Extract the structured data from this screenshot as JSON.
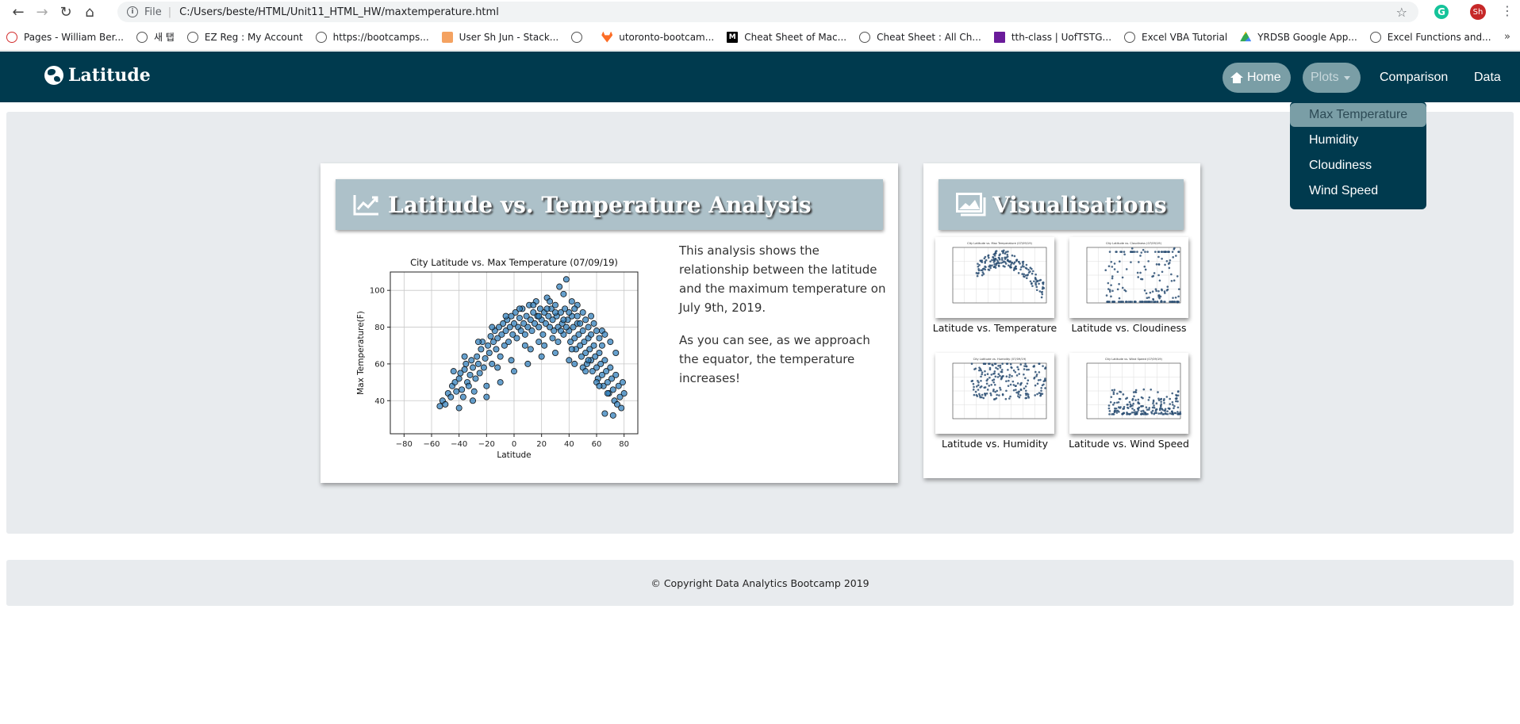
{
  "browser": {
    "address_prefix": "File",
    "url": "C:/Users/beste/HTML/Unit11_HTML_HW/maxtemperature.html",
    "grammarly_letter": "G",
    "avatar_initials": "Sh",
    "bookmarks": [
      {
        "label": "Pages - William Ber...",
        "icon": "red-swoosh-icon"
      },
      {
        "label": "새 탭",
        "icon": "globe-icon"
      },
      {
        "label": "EZ Reg : My Account",
        "icon": "globe-icon"
      },
      {
        "label": "https://bootcamps...",
        "icon": "globe-icon"
      },
      {
        "label": "User Sh Jun - Stack...",
        "icon": "stackoverflow-icon"
      },
      {
        "label": "",
        "icon": "globe-icon"
      },
      {
        "label": "utoronto-bootcam...",
        "icon": "gitlab-icon"
      },
      {
        "label": "Cheat Sheet of Mac...",
        "icon": "medium-icon"
      },
      {
        "label": "Cheat Sheet : All Ch...",
        "icon": "globe-icon"
      },
      {
        "label": "tth-class | UofTSTG...",
        "icon": "purple-square-icon"
      },
      {
        "label": "Excel VBA Tutorial",
        "icon": "globe-icon"
      },
      {
        "label": "YRDSB Google App...",
        "icon": "drive-icon"
      },
      {
        "label": "Excel Functions and...",
        "icon": "globe-icon"
      }
    ],
    "more": "»"
  },
  "nav": {
    "brand": "Latitude",
    "home": "Home",
    "plots": "Plots",
    "comparison": "Comparison",
    "data": "Data",
    "dropdown": [
      "Max Temperature",
      "Humidity",
      "Cloudiness",
      "Wind Speed"
    ]
  },
  "main": {
    "title": "Latitude vs. Temperature Analysis",
    "para1": "This analysis shows the relationship between the latitude and the maximum temperature on July 9th, 2019.",
    "para2": "As you can see, as we approach the equator, the temperature increases!"
  },
  "visualisations": {
    "title": "Visualisations",
    "thumbs": [
      {
        "label": "Latitude vs. Temperature",
        "caption": "City Latitude vs. Max Temperature (07/09/19)"
      },
      {
        "label": "Latitude vs. Cloudiness",
        "caption": "City Latitude vs. Cloudiness (07/09/19)"
      },
      {
        "label": "Latitude vs. Humidity",
        "caption": "City Latitude vs. Humidity (07/09/19)"
      },
      {
        "label": "Latitude vs. Wind Speed",
        "caption": "City Latitude vs. Wind Speed (07/09/19)"
      }
    ]
  },
  "footer": {
    "text": "© Copyright Data Analytics Bootcamp 2019"
  },
  "chart_data": {
    "type": "scatter",
    "title": "City Latitude vs. Max Temperature (07/09/19)",
    "xlabel": "Latitude",
    "ylabel": "Max Temperature(F)",
    "xlim": [
      -90,
      90
    ],
    "ylim": [
      22,
      110
    ],
    "xticks": [
      -80,
      -60,
      -40,
      -20,
      0,
      20,
      40,
      60,
      80
    ],
    "yticks": [
      40,
      60,
      80,
      100
    ],
    "grid": true,
    "marker_color": "#2b7bba",
    "points": [
      [
        -54,
        37
      ],
      [
        -52,
        40
      ],
      [
        -48,
        44
      ],
      [
        -46,
        42
      ],
      [
        -45,
        48
      ],
      [
        -43,
        50
      ],
      [
        -42,
        45
      ],
      [
        -40,
        52
      ],
      [
        -39,
        55
      ],
      [
        -38,
        46
      ],
      [
        -37,
        42
      ],
      [
        -36,
        57
      ],
      [
        -35,
        60
      ],
      [
        -34,
        50
      ],
      [
        -33,
        48
      ],
      [
        -32,
        54
      ],
      [
        -31,
        62
      ],
      [
        -30,
        58
      ],
      [
        -29,
        45
      ],
      [
        -28,
        52
      ],
      [
        -27,
        64
      ],
      [
        -26,
        60
      ],
      [
        -25,
        55
      ],
      [
        -24,
        68
      ],
      [
        -23,
        72
      ],
      [
        -22,
        58
      ],
      [
        -21,
        63
      ],
      [
        -20,
        48
      ],
      [
        -19,
        70
      ],
      [
        -18,
        66
      ],
      [
        -17,
        75
      ],
      [
        -16,
        60
      ],
      [
        -15,
        72
      ],
      [
        -14,
        78
      ],
      [
        -13,
        68
      ],
      [
        -12,
        74
      ],
      [
        -11,
        80
      ],
      [
        -10,
        64
      ],
      [
        -9,
        76
      ],
      [
        -8,
        82
      ],
      [
        -7,
        70
      ],
      [
        -6,
        78
      ],
      [
        -5,
        84
      ],
      [
        -4,
        72
      ],
      [
        -3,
        80
      ],
      [
        -2,
        86
      ],
      [
        -1,
        76
      ],
      [
        0,
        82
      ],
      [
        1,
        88
      ],
      [
        2,
        74
      ],
      [
        3,
        80
      ],
      [
        4,
        85
      ],
      [
        5,
        78
      ],
      [
        6,
        90
      ],
      [
        7,
        82
      ],
      [
        8,
        76
      ],
      [
        9,
        86
      ],
      [
        10,
        80
      ],
      [
        11,
        92
      ],
      [
        12,
        84
      ],
      [
        13,
        78
      ],
      [
        14,
        88
      ],
      [
        15,
        82
      ],
      [
        16,
        94
      ],
      [
        17,
        86
      ],
      [
        18,
        80
      ],
      [
        19,
        90
      ],
      [
        20,
        84
      ],
      [
        21,
        76
      ],
      [
        22,
        88
      ],
      [
        23,
        82
      ],
      [
        24,
        96
      ],
      [
        25,
        86
      ],
      [
        26,
        80
      ],
      [
        27,
        90
      ],
      [
        28,
        84
      ],
      [
        29,
        78
      ],
      [
        30,
        92
      ],
      [
        31,
        86
      ],
      [
        32,
        80
      ],
      [
        33,
        102
      ],
      [
        34,
        88
      ],
      [
        35,
        82
      ],
      [
        36,
        76
      ],
      [
        37,
        90
      ],
      [
        38,
        106
      ],
      [
        39,
        84
      ],
      [
        40,
        78
      ],
      [
        41,
        72
      ],
      [
        42,
        86
      ],
      [
        43,
        80
      ],
      [
        44,
        74
      ],
      [
        45,
        68
      ],
      [
        46,
        82
      ],
      [
        47,
        76
      ],
      [
        48,
        70
      ],
      [
        49,
        64
      ],
      [
        50,
        78
      ],
      [
        51,
        72
      ],
      [
        52,
        66
      ],
      [
        53,
        60
      ],
      [
        54,
        74
      ],
      [
        55,
        68
      ],
      [
        56,
        62
      ],
      [
        57,
        56
      ],
      [
        58,
        70
      ],
      [
        59,
        64
      ],
      [
        60,
        58
      ],
      [
        61,
        52
      ],
      [
        62,
        66
      ],
      [
        63,
        60
      ],
      [
        64,
        54
      ],
      [
        65,
        48
      ],
      [
        66,
        62
      ],
      [
        67,
        56
      ],
      [
        68,
        50
      ],
      [
        69,
        44
      ],
      [
        70,
        58
      ],
      [
        71,
        52
      ],
      [
        72,
        46
      ],
      [
        73,
        40
      ],
      [
        74,
        54
      ],
      [
        75,
        38
      ],
      [
        76,
        48
      ],
      [
        77,
        42
      ],
      [
        78,
        36
      ],
      [
        79,
        50
      ],
      [
        80,
        44
      ],
      [
        66,
        33
      ],
      [
        72,
        32
      ],
      [
        -44,
        56
      ],
      [
        -36,
        64
      ],
      [
        -26,
        72
      ],
      [
        -16,
        80
      ],
      [
        -6,
        86
      ],
      [
        4,
        90
      ],
      [
        14,
        92
      ],
      [
        26,
        94
      ],
      [
        36,
        98
      ],
      [
        46,
        92
      ],
      [
        56,
        86
      ],
      [
        64,
        78
      ],
      [
        70,
        72
      ],
      [
        74,
        66
      ],
      [
        -30,
        40
      ],
      [
        -20,
        42
      ],
      [
        -10,
        50
      ],
      [
        0,
        56
      ],
      [
        10,
        60
      ],
      [
        20,
        64
      ],
      [
        30,
        66
      ],
      [
        40,
        62
      ],
      [
        50,
        58
      ],
      [
        60,
        50
      ],
      [
        -50,
        38
      ],
      [
        -40,
        36
      ],
      [
        8,
        70
      ],
      [
        18,
        72
      ],
      [
        28,
        74
      ],
      [
        44,
        60
      ],
      [
        52,
        56
      ],
      [
        62,
        48
      ],
      [
        68,
        44
      ],
      [
        -12,
        58
      ],
      [
        -2,
        62
      ],
      [
        12,
        68
      ],
      [
        22,
        70
      ],
      [
        32,
        72
      ],
      [
        42,
        68
      ],
      [
        54,
        62
      ],
      [
        38,
        80
      ],
      [
        40,
        88
      ],
      [
        42,
        94
      ],
      [
        44,
        90
      ],
      [
        46,
        86
      ],
      [
        48,
        82
      ],
      [
        50,
        88
      ],
      [
        52,
        84
      ],
      [
        54,
        80
      ],
      [
        56,
        76
      ],
      [
        58,
        82
      ],
      [
        60,
        78
      ],
      [
        62,
        74
      ],
      [
        64,
        70
      ],
      [
        66,
        76
      ],
      [
        34,
        78
      ],
      [
        36,
        84
      ],
      [
        30,
        88
      ],
      [
        24,
        90
      ],
      [
        18,
        86
      ]
    ]
  }
}
